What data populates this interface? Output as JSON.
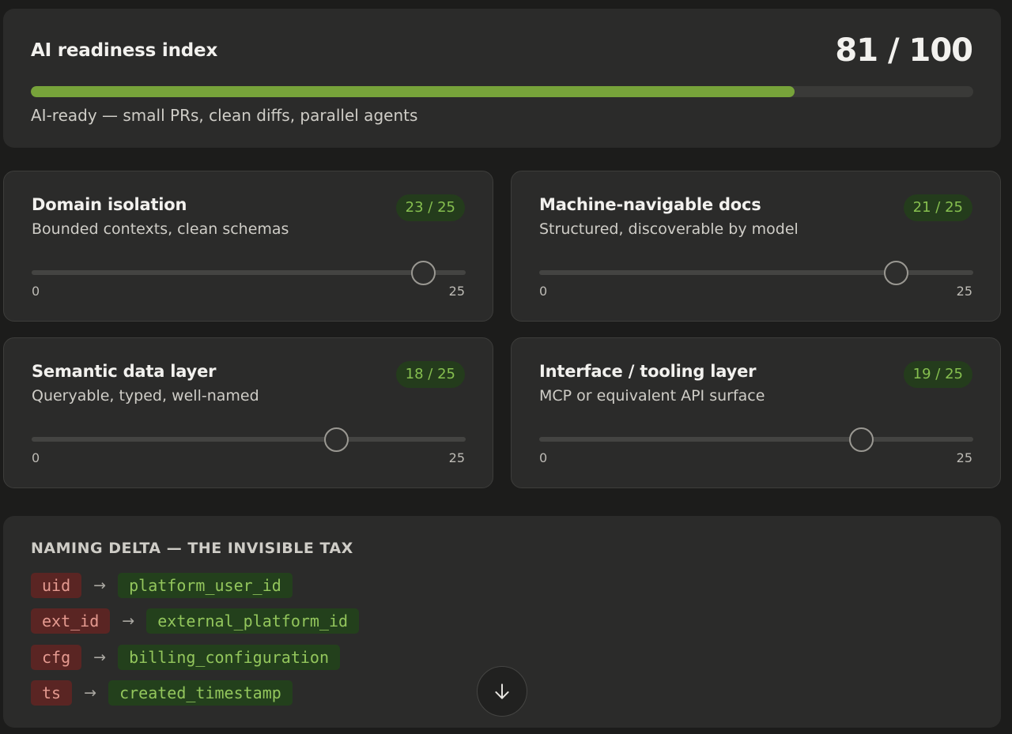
{
  "index": {
    "title": "AI readiness index",
    "score_text": "81 / 100",
    "score": 81,
    "max": 100,
    "caption": "AI-ready — small PRs, clean diffs, parallel agents",
    "fill_color": "#77a33a"
  },
  "metrics": [
    {
      "title": "Domain isolation",
      "subtitle": "Bounded contexts, clean schemas",
      "badge": "23 / 25",
      "value": 23,
      "min_label": "0",
      "max_label": "25",
      "max": 25
    },
    {
      "title": "Machine-navigable docs",
      "subtitle": "Structured, discoverable by model",
      "badge": "21 / 25",
      "value": 21,
      "min_label": "0",
      "max_label": "25",
      "max": 25
    },
    {
      "title": "Semantic data layer",
      "subtitle": "Queryable, typed, well-named",
      "badge": "18 / 25",
      "value": 18,
      "min_label": "0",
      "max_label": "25",
      "max": 25
    },
    {
      "title": "Interface / tooling layer",
      "subtitle": "MCP or equivalent API surface",
      "badge": "19 / 25",
      "value": 19,
      "min_label": "0",
      "max_label": "25",
      "max": 25
    }
  ],
  "naming": {
    "title": "NAMING DELTA — THE INVISIBLE TAX",
    "rows": [
      {
        "old": "uid",
        "new": "platform_user_id"
      },
      {
        "old": "ext_id",
        "new": "external_platform_id"
      },
      {
        "old": "cfg",
        "new": "billing_configuration"
      },
      {
        "old": "ts",
        "new": "created_timestamp"
      }
    ],
    "arrow_icon": "arrow-right-icon",
    "scroll_icon": "arrow-down-icon"
  }
}
